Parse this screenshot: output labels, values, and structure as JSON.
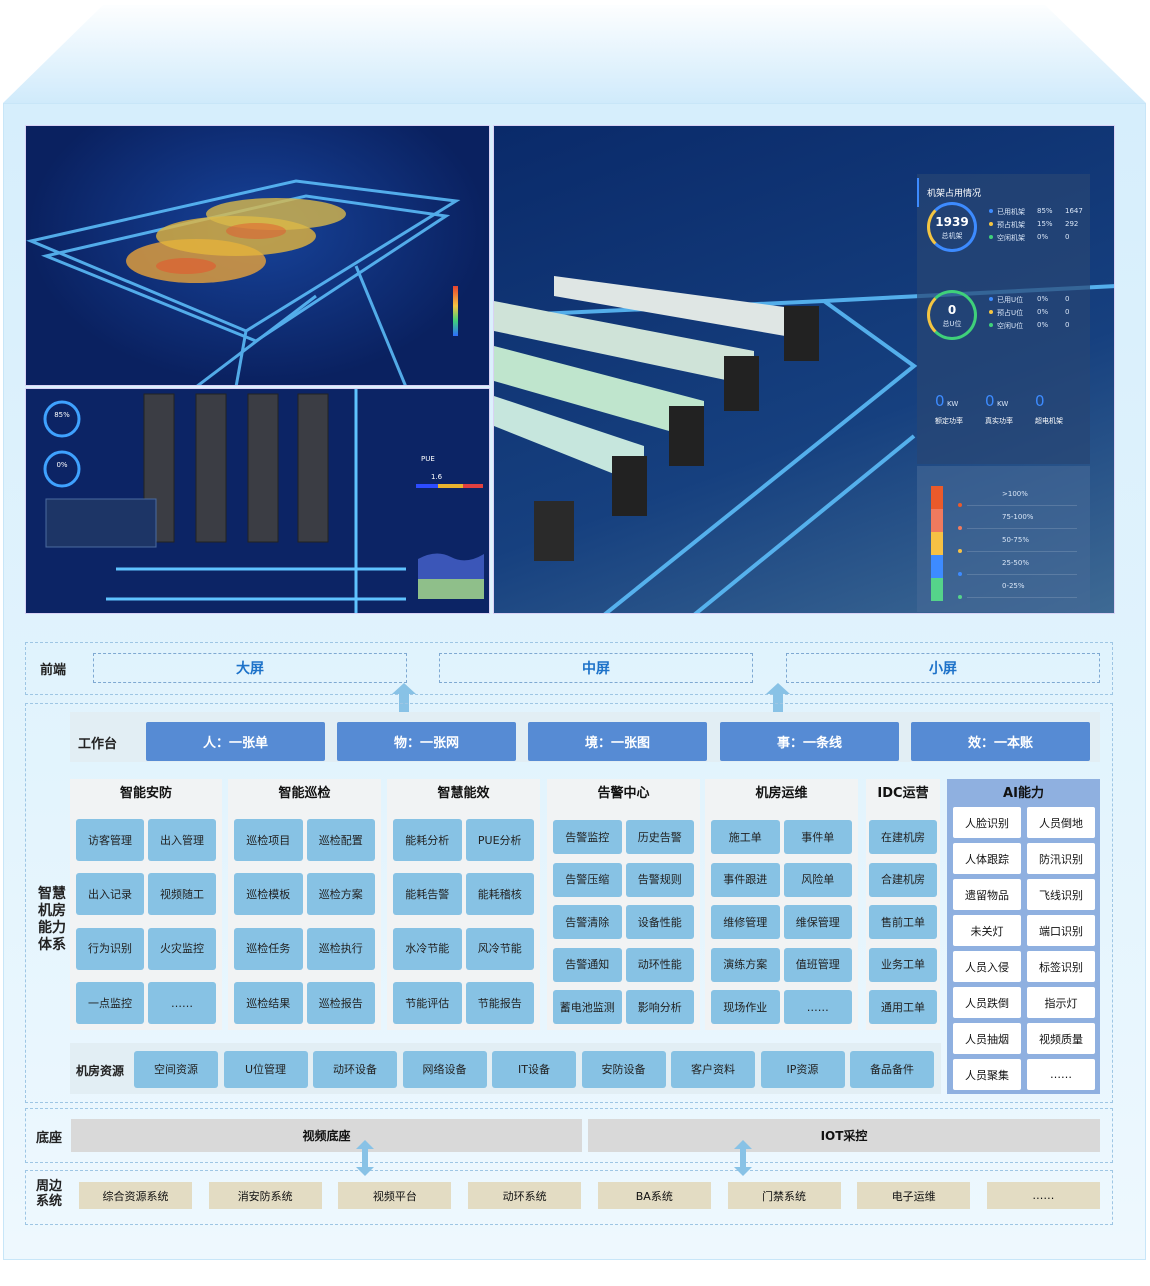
{
  "screens_preview": {
    "rack_panel": {
      "title": "机架占用情况",
      "rack_ring": {
        "value": "1939",
        "label": "总机架",
        "rows": [
          {
            "name": "已用机架",
            "pct": "85%",
            "count": "1647",
            "color": "#3d8bff"
          },
          {
            "name": "预占机架",
            "pct": "15%",
            "count": "292",
            "color": "#f4c542"
          },
          {
            "name": "空闲机架",
            "pct": "0%",
            "count": "0",
            "color": "#3fd07a"
          }
        ]
      },
      "u_ring": {
        "value": "0",
        "label": "总U位",
        "rows": [
          {
            "name": "已用U位",
            "pct": "0%",
            "count": "0",
            "color": "#3d8bff"
          },
          {
            "name": "预占U位",
            "pct": "0%",
            "count": "0",
            "color": "#f4c542"
          },
          {
            "name": "空闲U位",
            "pct": "0%",
            "count": "0",
            "color": "#3fd07a"
          }
        ]
      },
      "stats": [
        {
          "value": "0",
          "unit": "KW",
          "label": "额定功率"
        },
        {
          "value": "0",
          "unit": "KW",
          "label": "真实功率"
        },
        {
          "value": "0",
          "unit": "",
          "label": "超电机架"
        }
      ],
      "heat_legend": [
        {
          "label": ">100%",
          "color": "#ea5a2a"
        },
        {
          "label": "75-100%",
          "color": "#ef7a5e"
        },
        {
          "label": "50-75%",
          "color": "#f6c144"
        },
        {
          "label": "25-50%",
          "color": "#3d8bff"
        },
        {
          "label": "0-25%",
          "color": "#55d38a"
        }
      ]
    },
    "pue_label": "PUE",
    "pue_value": "1.6",
    "gauge_pcts": [
      "85%",
      "0%"
    ]
  },
  "frontend": {
    "label": "前端",
    "screens": [
      "大屏",
      "中屏",
      "小屏"
    ]
  },
  "capability": {
    "label": "智慧机房能力体系",
    "workbench": {
      "label": "工作台",
      "items": [
        "人：一张单",
        "物：一张网",
        "境：一张图",
        "事：一条线",
        "效：一本账"
      ]
    },
    "modules": [
      {
        "title": "智能安防",
        "items": [
          "访客管理",
          "出入管理",
          "出入记录",
          "视频随工",
          "行为识别",
          "火灾监控",
          "一点监控",
          "……"
        ]
      },
      {
        "title": "智能巡检",
        "items": [
          "巡检项目",
          "巡检配置",
          "巡检模板",
          "巡检方案",
          "巡检任务",
          "巡检执行",
          "巡检结果",
          "巡检报告"
        ]
      },
      {
        "title": "智慧能效",
        "items": [
          "能耗分析",
          "PUE分析",
          "能耗告警",
          "能耗稽核",
          "水冷节能",
          "风冷节能",
          "节能评估",
          "节能报告"
        ]
      },
      {
        "title": "告警中心",
        "items": [
          "告警监控",
          "历史告警",
          "告警压缩",
          "告警规则",
          "告警清除",
          "设备性能",
          "告警通知",
          "动环性能",
          "蓄电池监测",
          "影响分析"
        ]
      },
      {
        "title": "机房运维",
        "items": [
          "施工单",
          "事件单",
          "事件跟进",
          "风险单",
          "维修管理",
          "维保管理",
          "演练方案",
          "值班管理",
          "现场作业",
          "……"
        ]
      },
      {
        "title": "IDC运营",
        "items": [
          "在建机房",
          "合建机房",
          "售前工单",
          "业务工单",
          "通用工单"
        ]
      }
    ],
    "ai": {
      "title": "AI能力",
      "items": [
        "人脸识别",
        "人员倒地",
        "人体跟踪",
        "防汛识别",
        "遗留物品",
        "飞线识别",
        "未关灯",
        "端口识别",
        "人员入侵",
        "标签识别",
        "人员跌倒",
        "指示灯",
        "人员抽烟",
        "视频质量",
        "人员聚集",
        "……"
      ]
    },
    "resources": {
      "label": "机房资源",
      "items": [
        "空间资源",
        "U位管理",
        "动环设备",
        "网络设备",
        "IT设备",
        "安防设备",
        "客户资料",
        "IP资源",
        "备品备件"
      ]
    }
  },
  "base": {
    "label": "底座",
    "items": [
      "视频底座",
      "IOT采控"
    ]
  },
  "peripheral": {
    "label": "周边系统",
    "items": [
      "综合资源系统",
      "消安防系统",
      "视频平台",
      "动环系统",
      "BA系统",
      "门禁系统",
      "电子运维",
      "……"
    ]
  },
  "colors": {
    "workbench": "#568bd4",
    "item": "#87c2e4",
    "ai_panel": "#8fb0e0",
    "arrow": "#88c2e6",
    "peripheral": "#e3dcc3",
    "base": "#d9d9d9"
  }
}
